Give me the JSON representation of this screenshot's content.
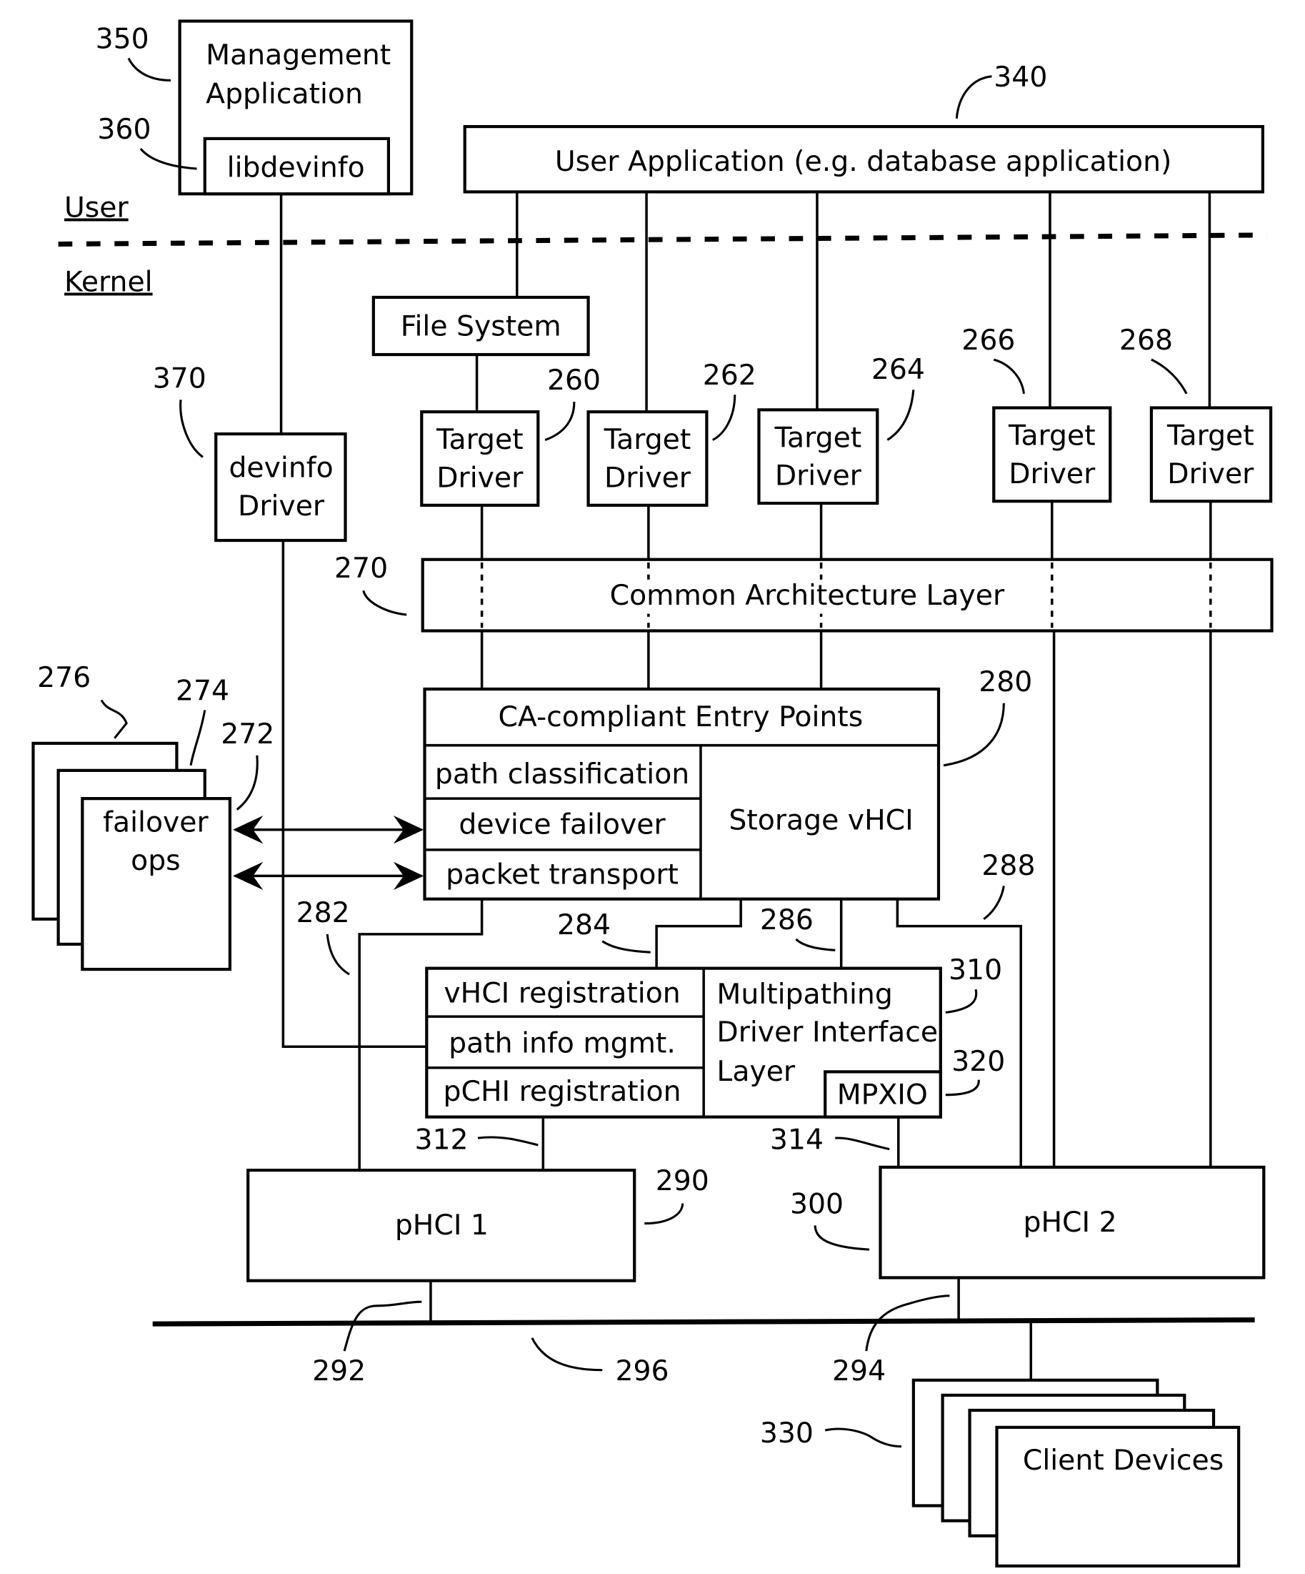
{
  "figure": {
    "section_labels": {
      "user": "User",
      "kernel": "Kernel"
    },
    "management_app": {
      "ref": "350",
      "line1": "Management",
      "line2": "Application"
    },
    "libdevinfo": {
      "ref": "360",
      "label": "libdevinfo"
    },
    "user_application": {
      "ref": "340",
      "label": "User Application (e.g. database application)"
    },
    "file_system": {
      "label": "File System"
    },
    "devinfo_driver": {
      "ref": "370",
      "line1": "devinfo",
      "line2": "Driver"
    },
    "target_drivers": [
      {
        "ref": "260",
        "line1": "Target",
        "line2": "Driver"
      },
      {
        "ref": "262",
        "line1": "Target",
        "line2": "Driver"
      },
      {
        "ref": "264",
        "line1": "Target",
        "line2": "Driver"
      },
      {
        "ref": "266",
        "line1": "Target",
        "line2": "Driver"
      },
      {
        "ref": "268",
        "line1": "Target",
        "line2": "Driver"
      }
    ],
    "common_arch_layer": {
      "ref": "270",
      "label": "Common Architecture Layer"
    },
    "failover_ops": {
      "refs": [
        "276",
        "274",
        "272"
      ],
      "line1": "failover",
      "line2": "ops"
    },
    "storage_vhci": {
      "ref": "280",
      "entry_points": "CA-compliant Entry Points",
      "label": "Storage vHCI",
      "modules": [
        "path classification",
        "device failover",
        "packet transport"
      ]
    },
    "mdi_layer": {
      "refs": {
        "layer": "310",
        "mpxio": "320"
      },
      "modules": [
        "vHCI registration",
        "path info mgmt.",
        "pCHI registration"
      ],
      "line1": "Multipathing",
      "line2": "Driver Interface",
      "line3": "Layer",
      "mpxio": "MPXIO"
    },
    "connector_refs": {
      "r282": "282",
      "r284": "284",
      "r286": "286",
      "r288": "288",
      "r312": "312",
      "r314": "314"
    },
    "phci1": {
      "ref": "290",
      "label": "pHCI 1"
    },
    "phci2": {
      "ref": "300",
      "label": "pHCI 2"
    },
    "bus": {
      "ref": "296",
      "link1": "292",
      "link2": "294"
    },
    "client_devices": {
      "ref": "330",
      "label": "Client Devices"
    }
  }
}
